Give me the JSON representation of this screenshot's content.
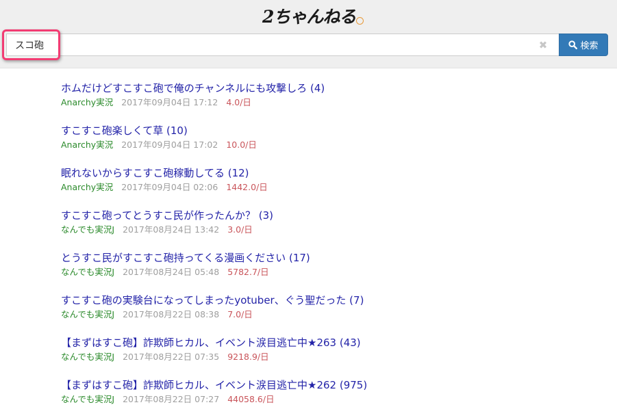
{
  "logo": {
    "text": "2ちゃんねる"
  },
  "search": {
    "value": "スコ砲",
    "clear_glyph": "✖",
    "button_label": "検索"
  },
  "results": [
    {
      "title": "ホムだけどすこすこ砲で俺のチャンネルにも攻撃しろ (4)",
      "board": "Anarchy実況",
      "date": "2017年09月04日 17:12",
      "speed": "4.0/日"
    },
    {
      "title": "すこすこ砲楽しくて草 (10)",
      "board": "Anarchy実況",
      "date": "2017年09月04日 17:02",
      "speed": "10.0/日"
    },
    {
      "title": "眠れないからすこすこ砲稼動してる (12)",
      "board": "Anarchy実況",
      "date": "2017年09月04日 02:06",
      "speed": "1442.0/日"
    },
    {
      "title": "すこすこ砲ってとうすこ民が作ったんか？ (3)",
      "board": "なんでも実況J",
      "date": "2017年08月24日 13:42",
      "speed": "3.0/日"
    },
    {
      "title": "とうすこ民がすこすこ砲持ってくる漫画ください (17)",
      "board": "なんでも実況J",
      "date": "2017年08月24日 05:48",
      "speed": "5782.7/日"
    },
    {
      "title": "すこすこ砲の実験台になってしまったyotuber、ぐう聖だった (7)",
      "board": "なんでも実況J",
      "date": "2017年08月22日 08:38",
      "speed": "7.0/日"
    },
    {
      "title": "【まずはすこ砲】詐欺師ヒカル、イベント涙目逃亡中★263 (43)",
      "board": "なんでも実況J",
      "date": "2017年08月22日 07:35",
      "speed": "9218.9/日"
    },
    {
      "title": "【まずはすこ砲】詐欺師ヒカル、イベント涙目逃亡中★262 (975)",
      "board": "なんでも実況J",
      "date": "2017年08月22日 07:27",
      "speed": "44058.6/日"
    }
  ],
  "colors": {
    "title_link": "#2323a8",
    "board": "#2b8a2b",
    "date": "#9e9e9e",
    "speed": "#c9545a",
    "button": "#337ab7",
    "highlight": "#f23c73"
  }
}
